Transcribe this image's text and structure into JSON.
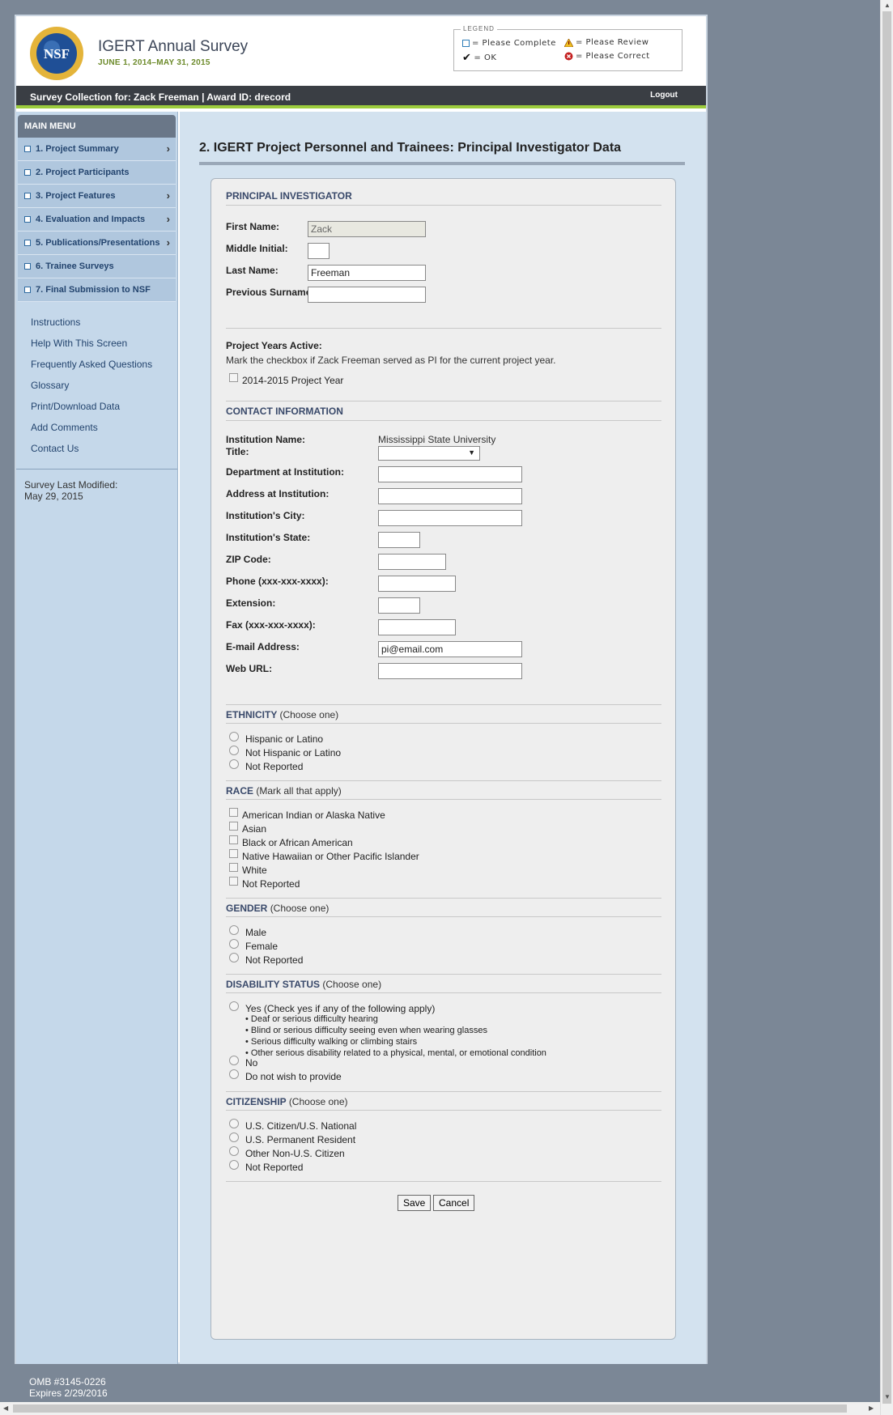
{
  "header": {
    "title": "IGERT Annual Survey",
    "dates": "JUNE 1, 2014–MAY 31, 2015",
    "logo_text": "NSF"
  },
  "legend": {
    "title": "LEGEND",
    "complete": "= Please Complete",
    "review": "= Please Review",
    "ok": "= OK",
    "correct": "= Please Correct"
  },
  "topbar": {
    "collection": "Survey Collection for: Zack Freeman | Award ID: drecord",
    "logout": "Logout"
  },
  "sidebar": {
    "menu_title": "MAIN MENU",
    "items": [
      {
        "label": "1. Project Summary",
        "chevron": true
      },
      {
        "label": "2. Project Participants",
        "chevron": false
      },
      {
        "label": "3. Project Features",
        "chevron": true
      },
      {
        "label": "4. Evaluation and Impacts",
        "chevron": true
      },
      {
        "label": "5. Publications/Presentations",
        "chevron": true
      },
      {
        "label": "6. Trainee Surveys",
        "chevron": false
      },
      {
        "label": "7. Final Submission to NSF",
        "chevron": false
      }
    ],
    "links": [
      "Instructions",
      "Help With This Screen",
      "Frequently Asked Questions",
      "Glossary",
      "Print/Download Data",
      "Add Comments",
      "Contact Us"
    ],
    "modified_label": "Survey Last Modified:",
    "modified_date": "May 29, 2015"
  },
  "main": {
    "heading": "2. IGERT Project Personnel and Trainees: Principal Investigator Data",
    "pi": {
      "section": "PRINCIPAL INVESTIGATOR",
      "first_name_label": "First Name:",
      "first_name": "Zack",
      "middle_label": "Middle Initial:",
      "middle": "",
      "last_name_label": "Last Name:",
      "last_name": "Freeman",
      "prev_label": "Previous Surname:",
      "prev": ""
    },
    "years": {
      "title": "Project Years Active:",
      "instruction": "Mark the checkbox if Zack Freeman served as PI for the current project year.",
      "year": "2014-2015 Project Year"
    },
    "contact": {
      "section": "CONTACT INFORMATION",
      "institution_label": "Institution Name:",
      "institution": "Mississippi State University",
      "title_label": "Title:",
      "dept_label": "Department at Institution:",
      "address_label": "Address at Institution:",
      "city_label": "Institution's City:",
      "state_label": "Institution's State:",
      "zip_label": "ZIP Code:",
      "phone_label": "Phone (xxx-xxx-xxxx):",
      "ext_label": "Extension:",
      "fax_label": "Fax (xxx-xxx-xxxx):",
      "email_label": "E-mail Address:",
      "email": "pi@email.com",
      "web_label": "Web URL:"
    },
    "ethnicity": {
      "title": "ETHNICITY",
      "sub": "(Choose one)",
      "options": [
        "Hispanic or Latino",
        "Not Hispanic or Latino",
        "Not Reported"
      ]
    },
    "race": {
      "title": "RACE",
      "sub": "(Mark all that apply)",
      "options": [
        "American Indian or Alaska Native",
        "Asian",
        "Black or African American",
        "Native Hawaiian or Other Pacific Islander",
        "White",
        "Not Reported"
      ]
    },
    "gender": {
      "title": "GENDER",
      "sub": "(Choose one)",
      "options": [
        "Male",
        "Female",
        "Not Reported"
      ]
    },
    "disability": {
      "title": "DISABILITY STATUS",
      "sub": "(Choose one)",
      "yes": "Yes (Check yes if any of the following apply)",
      "bullets": [
        "• Deaf or serious difficulty hearing",
        "• Blind or serious difficulty seeing even when wearing glasses",
        "• Serious difficulty walking or climbing stairs",
        "• Other serious disability related to a physical, mental, or emotional condition"
      ],
      "no": "No",
      "nowish": "Do not wish to provide"
    },
    "citizenship": {
      "title": "CITIZENSHIP",
      "sub": "(Choose one)",
      "options": [
        "U.S. Citizen/U.S. National",
        "U.S. Permanent Resident",
        "Other Non-U.S. Citizen",
        "Not Reported"
      ]
    },
    "buttons": {
      "save": "Save",
      "cancel": "Cancel"
    }
  },
  "footer": {
    "omb": "OMB #3145-0226",
    "expires": "Expires 2/29/2016"
  }
}
